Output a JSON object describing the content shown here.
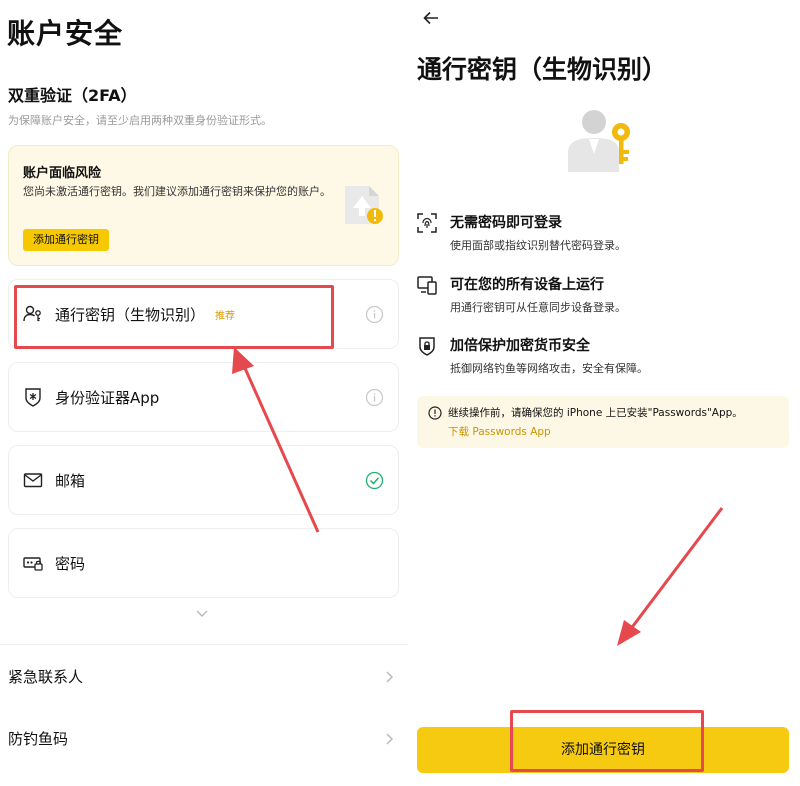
{
  "left": {
    "page_title": "账户安全",
    "section_title": "双重验证（2FA）",
    "section_desc": "为保障账户安全，请至少启用两种双重身份验证形式。",
    "risk_card": {
      "title": "账户面临风险",
      "desc": "您尚未激活通行密钥。我们建议添加通行密钥来保护您的账户。",
      "button": "添加通行密钥"
    },
    "options": [
      {
        "label": "通行密钥（生物识别）",
        "badge": "推荐",
        "icon": "passkey-user-icon",
        "status": "info"
      },
      {
        "label": "身份验证器App",
        "icon": "authenticator-shield-icon",
        "status": "info"
      },
      {
        "label": "邮箱",
        "icon": "mail-icon",
        "status": "enabled"
      },
      {
        "label": "密码",
        "icon": "password-icon",
        "status": "none"
      }
    ],
    "menu": [
      {
        "label": "紧急联系人"
      },
      {
        "label": "防钓鱼码"
      }
    ]
  },
  "right": {
    "title": "通行密钥（生物识别）",
    "features": [
      {
        "title": "无需密码即可登录",
        "desc": "使用面部或指纹识别替代密码登录。",
        "icon": "face-scan-icon"
      },
      {
        "title": "可在您的所有设备上运行",
        "desc": "用通行密钥可从任意同步设备登录。",
        "icon": "devices-icon"
      },
      {
        "title": "加倍保护加密货币安全",
        "desc": "抵御网络钓鱼等网络攻击，安全有保障。",
        "icon": "lock-shield-icon"
      }
    ],
    "notice": {
      "text": "继续操作前，请确保您的 iPhone 上已安装\"Passwords\"App。",
      "link": "下载 Passwords App"
    },
    "cta": "添加通行密钥"
  },
  "colors": {
    "accent": "#f7ca12",
    "highlight": "#e5484d",
    "link": "#c99500",
    "success": "#20b26c"
  }
}
